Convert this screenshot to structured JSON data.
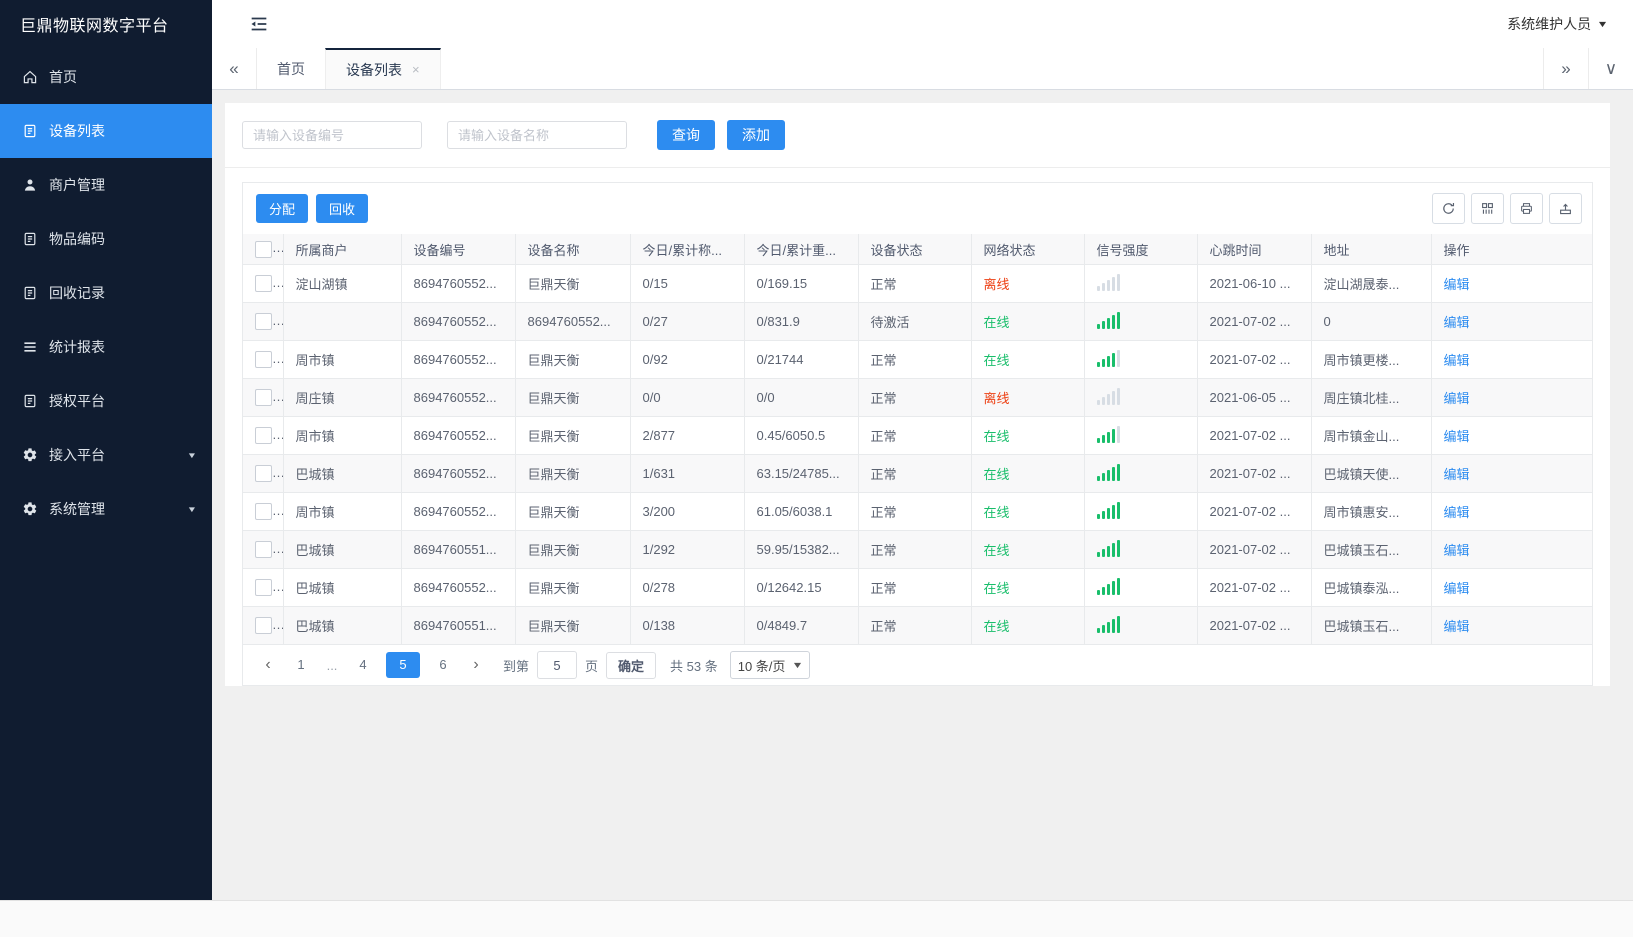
{
  "app": {
    "title": "巨鼎物联网数字平台",
    "user": "系统维护人员"
  },
  "colors": {
    "accent": "#2d8cf0",
    "online_green": "#19be6b",
    "offline_red": "#ed4014",
    "sidebar_bg": "#101c30"
  },
  "sidebar": {
    "items": [
      {
        "label": "首页",
        "icon": "home",
        "active": false,
        "expandable": false
      },
      {
        "label": "设备列表",
        "icon": "doc",
        "active": true,
        "expandable": false
      },
      {
        "label": "商户管理",
        "icon": "user",
        "active": false,
        "expandable": false
      },
      {
        "label": "物品编码",
        "icon": "doc",
        "active": false,
        "expandable": false
      },
      {
        "label": "回收记录",
        "icon": "doc",
        "active": false,
        "expandable": false
      },
      {
        "label": "统计报表",
        "icon": "lines",
        "active": false,
        "expandable": false
      },
      {
        "label": "授权平台",
        "icon": "doc",
        "active": false,
        "expandable": false
      },
      {
        "label": "接入平台",
        "icon": "gear",
        "active": false,
        "expandable": true
      },
      {
        "label": "系统管理",
        "icon": "gear",
        "active": false,
        "expandable": true
      }
    ]
  },
  "tabs": {
    "collapse_left": "«",
    "collapse_right": "»",
    "dropdown": "∨",
    "items": [
      {
        "label": "首页",
        "active": false,
        "closable": false
      },
      {
        "label": "设备列表",
        "active": true,
        "closable": true,
        "close_glyph": "×"
      }
    ]
  },
  "search": {
    "device_no_placeholder": "请输入设备编号",
    "device_name_placeholder": "请输入设备名称",
    "query_label": "查询",
    "add_label": "添加"
  },
  "toolbar": {
    "assign_label": "分配",
    "recycle_label": "回收",
    "icons": [
      "refresh",
      "columns",
      "print",
      "export"
    ]
  },
  "table": {
    "columns": [
      "所属商户",
      "设备编号",
      "设备名称",
      "今日/累计称...",
      "今日/累计重...",
      "设备状态",
      "网络状态",
      "信号强度",
      "心跳时间",
      "地址",
      "操作"
    ],
    "rows": [
      {
        "merchant": "淀山湖镇",
        "device_no": "8694760552...",
        "device_name": "巨鼎天衡",
        "today_count": "0/15",
        "today_weight": "0/169.15",
        "device_status": "正常",
        "network_status": "离线",
        "online": false,
        "signal": 0,
        "heartbeat": "2021-06-10 ...",
        "address": "淀山湖晟泰...",
        "action": "编辑"
      },
      {
        "merchant": "",
        "device_no": "8694760552...",
        "device_name": "8694760552...",
        "today_count": "0/27",
        "today_weight": "0/831.9",
        "device_status": "待激活",
        "network_status": "在线",
        "online": true,
        "signal": 5,
        "heartbeat": "2021-07-02 ...",
        "address": "0",
        "action": "编辑"
      },
      {
        "merchant": "周市镇",
        "device_no": "8694760552...",
        "device_name": "巨鼎天衡",
        "today_count": "0/92",
        "today_weight": "0/21744",
        "device_status": "正常",
        "network_status": "在线",
        "online": true,
        "signal": 4,
        "heartbeat": "2021-07-02 ...",
        "address": "周市镇更楼...",
        "action": "编辑"
      },
      {
        "merchant": "周庄镇",
        "device_no": "8694760552...",
        "device_name": "巨鼎天衡",
        "today_count": "0/0",
        "today_weight": "0/0",
        "device_status": "正常",
        "network_status": "离线",
        "online": false,
        "signal": 0,
        "heartbeat": "2021-06-05 ...",
        "address": "周庄镇北桂...",
        "action": "编辑"
      },
      {
        "merchant": "周市镇",
        "device_no": "8694760552...",
        "device_name": "巨鼎天衡",
        "today_count": "2/877",
        "today_weight": "0.45/6050.5",
        "device_status": "正常",
        "network_status": "在线",
        "online": true,
        "signal": 4,
        "heartbeat": "2021-07-02 ...",
        "address": "周市镇金山...",
        "action": "编辑"
      },
      {
        "merchant": "巴城镇",
        "device_no": "8694760552...",
        "device_name": "巨鼎天衡",
        "today_count": "1/631",
        "today_weight": "63.15/24785...",
        "device_status": "正常",
        "network_status": "在线",
        "online": true,
        "signal": 5,
        "heartbeat": "2021-07-02 ...",
        "address": "巴城镇天使...",
        "action": "编辑"
      },
      {
        "merchant": "周市镇",
        "device_no": "8694760552...",
        "device_name": "巨鼎天衡",
        "today_count": "3/200",
        "today_weight": "61.05/6038.1",
        "device_status": "正常",
        "network_status": "在线",
        "online": true,
        "signal": 5,
        "heartbeat": "2021-07-02 ...",
        "address": "周市镇惠安...",
        "action": "编辑"
      },
      {
        "merchant": "巴城镇",
        "device_no": "8694760551...",
        "device_name": "巨鼎天衡",
        "today_count": "1/292",
        "today_weight": "59.95/15382...",
        "device_status": "正常",
        "network_status": "在线",
        "online": true,
        "signal": 5,
        "heartbeat": "2021-07-02 ...",
        "address": "巴城镇玉石...",
        "action": "编辑"
      },
      {
        "merchant": "巴城镇",
        "device_no": "8694760552...",
        "device_name": "巨鼎天衡",
        "today_count": "0/278",
        "today_weight": "0/12642.15",
        "device_status": "正常",
        "network_status": "在线",
        "online": true,
        "signal": 5,
        "heartbeat": "2021-07-02 ...",
        "address": "巴城镇泰泓...",
        "action": "编辑"
      },
      {
        "merchant": "巴城镇",
        "device_no": "8694760551...",
        "device_name": "巨鼎天衡",
        "today_count": "0/138",
        "today_weight": "0/4849.7",
        "device_status": "正常",
        "network_status": "在线",
        "online": true,
        "signal": 5,
        "heartbeat": "2021-07-02 ...",
        "address": "巴城镇玉石...",
        "action": "编辑"
      }
    ]
  },
  "pagination": {
    "prev": "‹",
    "next": "›",
    "pages": [
      "1",
      "...",
      "4",
      "5",
      "6"
    ],
    "active": "5",
    "goto_label": "到第",
    "goto_value": "5",
    "page_label": "页",
    "confirm_label": "确定",
    "total_label": "共 53 条",
    "page_size": "10 条/页"
  }
}
